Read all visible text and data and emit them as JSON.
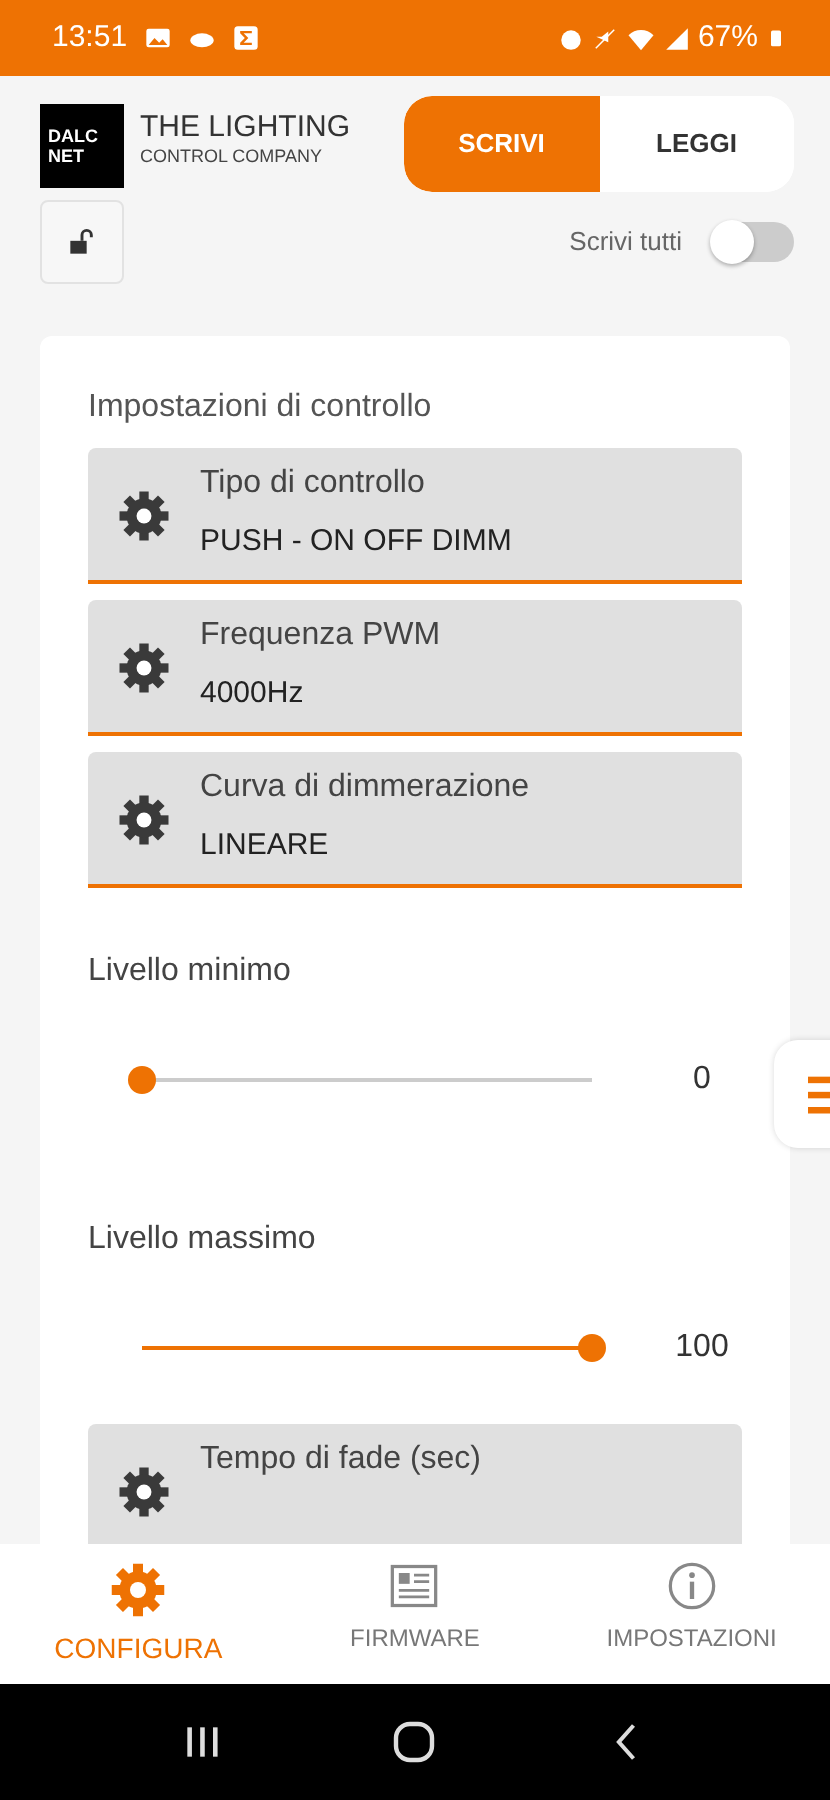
{
  "status_bar": {
    "time": "13:51",
    "battery": "67%"
  },
  "header": {
    "logo_lines": [
      "DALC",
      "NET"
    ],
    "brand_title": "THE LIGHTING",
    "brand_subtitle": "CONTROL COMPANY"
  },
  "mode_tabs": [
    {
      "label": "SCRIVI",
      "selected": true
    },
    {
      "label": "LEGGI",
      "selected": false
    }
  ],
  "lock": {
    "locked": false
  },
  "write_all": {
    "label": "Scrivi tutti",
    "on": false
  },
  "section_title": "Impostazioni di controllo",
  "settings": [
    {
      "kind": "select",
      "label": "Tipo di controllo",
      "value": "PUSH - ON OFF DIMM"
    },
    {
      "kind": "select",
      "label": "Frequenza PWM",
      "value": "4000Hz"
    },
    {
      "kind": "select",
      "label": "Curva di dimmerazione",
      "value": "LINEARE"
    },
    {
      "kind": "slider",
      "label": "Livello minimo",
      "level": 0,
      "reading": "0"
    },
    {
      "kind": "slider",
      "label": "Livello massimo",
      "level": 1,
      "reading": "100"
    },
    {
      "kind": "select",
      "label": "Tempo di fade (sec)"
    }
  ],
  "bottom_nav": [
    {
      "kind": "configure",
      "label": "CONFIGURA",
      "selected": true
    },
    {
      "kind": "firmware",
      "label": "FIRMWARE",
      "selected": false
    },
    {
      "kind": "settings",
      "label": "IMPOSTAZIONI",
      "selected": false
    }
  ]
}
